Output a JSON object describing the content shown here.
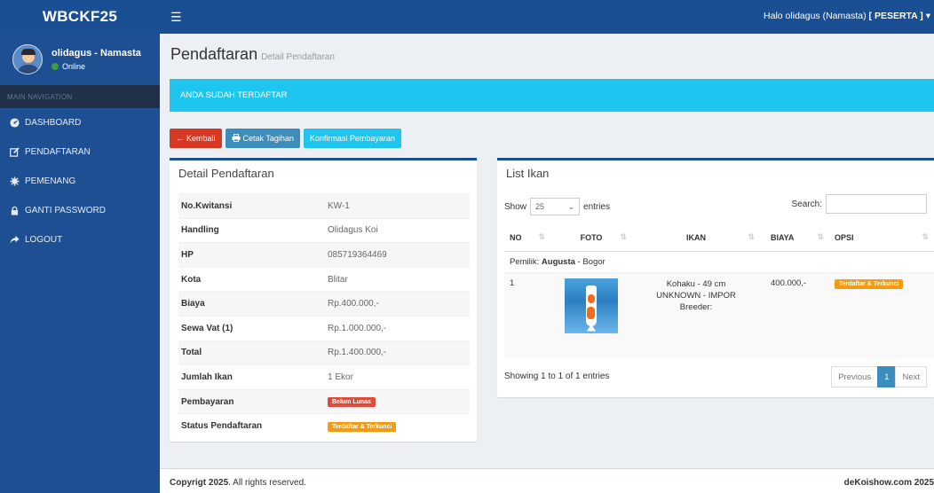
{
  "app": {
    "logo": "WBCKF25",
    "greeting_prefix": "Halo olidagus (Namasta)",
    "greeting_role": "[ PESERTA ]"
  },
  "user": {
    "name": "olidagus - Namasta",
    "status": "Online"
  },
  "sidebar": {
    "section": "MAIN NAVIGATION",
    "items": [
      {
        "label": "DASHBOARD",
        "icon": "dashboard-icon"
      },
      {
        "label": "PENDAFTARAN",
        "icon": "edit-icon"
      },
      {
        "label": "PEMENANG",
        "icon": "star-icon"
      },
      {
        "label": "GANTI PASSWORD",
        "icon": "lock-icon"
      },
      {
        "label": "LOGOUT",
        "icon": "share-icon"
      }
    ]
  },
  "page": {
    "title": "Pendaftaran",
    "subtitle": "Detail Pendaftaran",
    "alert": "ANDA SUDAH TERDAFTAR"
  },
  "buttons": {
    "back": "Kembali",
    "print": "Cetak Tagihan",
    "confirm": "Konfirmasi Pembayaran"
  },
  "detail": {
    "title": "Detail Pendaftaran",
    "rows": [
      {
        "label": "No.Kwitansi",
        "value": "KW-1"
      },
      {
        "label": "Handling",
        "value": "Olidagus Koi"
      },
      {
        "label": "HP",
        "value": "085719364469"
      },
      {
        "label": "Kota",
        "value": "Blitar"
      },
      {
        "label": "Biaya",
        "value": "Rp.400.000,-"
      },
      {
        "label": "Sewa Vat (1)",
        "value": "Rp.1.000.000,-"
      },
      {
        "label": "Total",
        "value": "Rp.1.400.000,-"
      },
      {
        "label": "Jumlah Ikan",
        "value": "1 Ekor"
      },
      {
        "label": "Pembayaran",
        "value": "Belum Lunas"
      },
      {
        "label": "Status Pendaftaran",
        "value": "Terdaftar & Terkunci"
      }
    ]
  },
  "fish_list": {
    "title": "List Ikan",
    "show_label": "Show",
    "entries_value": "25",
    "entries_label": "entries",
    "search_label": "Search:",
    "columns": [
      "NO",
      "FOTO",
      "IKAN",
      "BIAYA",
      "OPSI"
    ],
    "owner_prefix": "Pemilik:",
    "owner_name": "Augusta",
    "owner_city": "- Bogor",
    "rows": [
      {
        "no": "1",
        "ikan_line1": "Kohaku - 49 cm",
        "ikan_line2": "UNKNOWN - IMPOR",
        "ikan_line3": "Breeder:",
        "biaya": "400.000,-",
        "opsi": "Terdaftar & Terkunci"
      }
    ],
    "info": "Showing 1 to 1 of 1 entries",
    "pager": {
      "prev": "Previous",
      "page": "1",
      "next": "Next"
    }
  },
  "footer": {
    "copyright_bold": "Copyrigt 2025",
    "copyright_rest": ". All rights reserved.",
    "brand": "deKoishow.com 2025"
  },
  "colors": {
    "primary": "#1a4f94",
    "accent": "#1ec6ef",
    "danger": "#dd4b39",
    "warning": "#f39c12"
  }
}
